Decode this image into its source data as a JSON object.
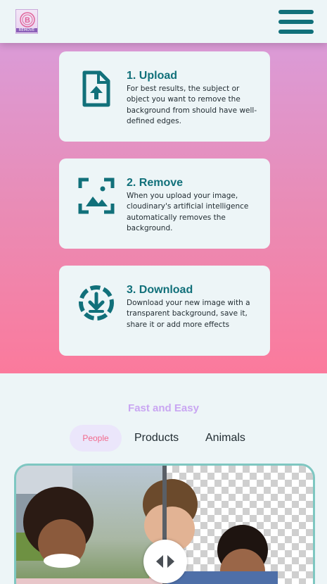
{
  "header": {
    "logo_text": "REMOVE",
    "logo_letter": "B",
    "menu_icon": "hamburger-menu-icon"
  },
  "steps": [
    {
      "title": "1. Upload",
      "description": "For best results, the subject or object you want to remove the background from should have well-defined edges.",
      "icon": "upload-file-icon"
    },
    {
      "title": "2. Remove",
      "description": "When you upload your image, cloudinary's artificial intelligence automatically removes the background.",
      "icon": "image-frame-icon"
    },
    {
      "title": "3. Download",
      "description": "Download your new image with a transparent background, save it, share it or add more effects",
      "icon": "download-circle-icon"
    }
  ],
  "gallery": {
    "section_title": "Fast and Easy",
    "tabs": [
      "People",
      "Products",
      "Animals"
    ],
    "active_tab": "People",
    "comparison_handle_icon": "left-right-arrows-icon"
  },
  "colors": {
    "accent": "#11707a",
    "hero_top": "#d79fe0",
    "hero_bottom": "#fb7a9c",
    "tab_active_text": "#f26a8d",
    "section_title": "#c9a6f2",
    "compare_border": "#7ec7c1"
  }
}
